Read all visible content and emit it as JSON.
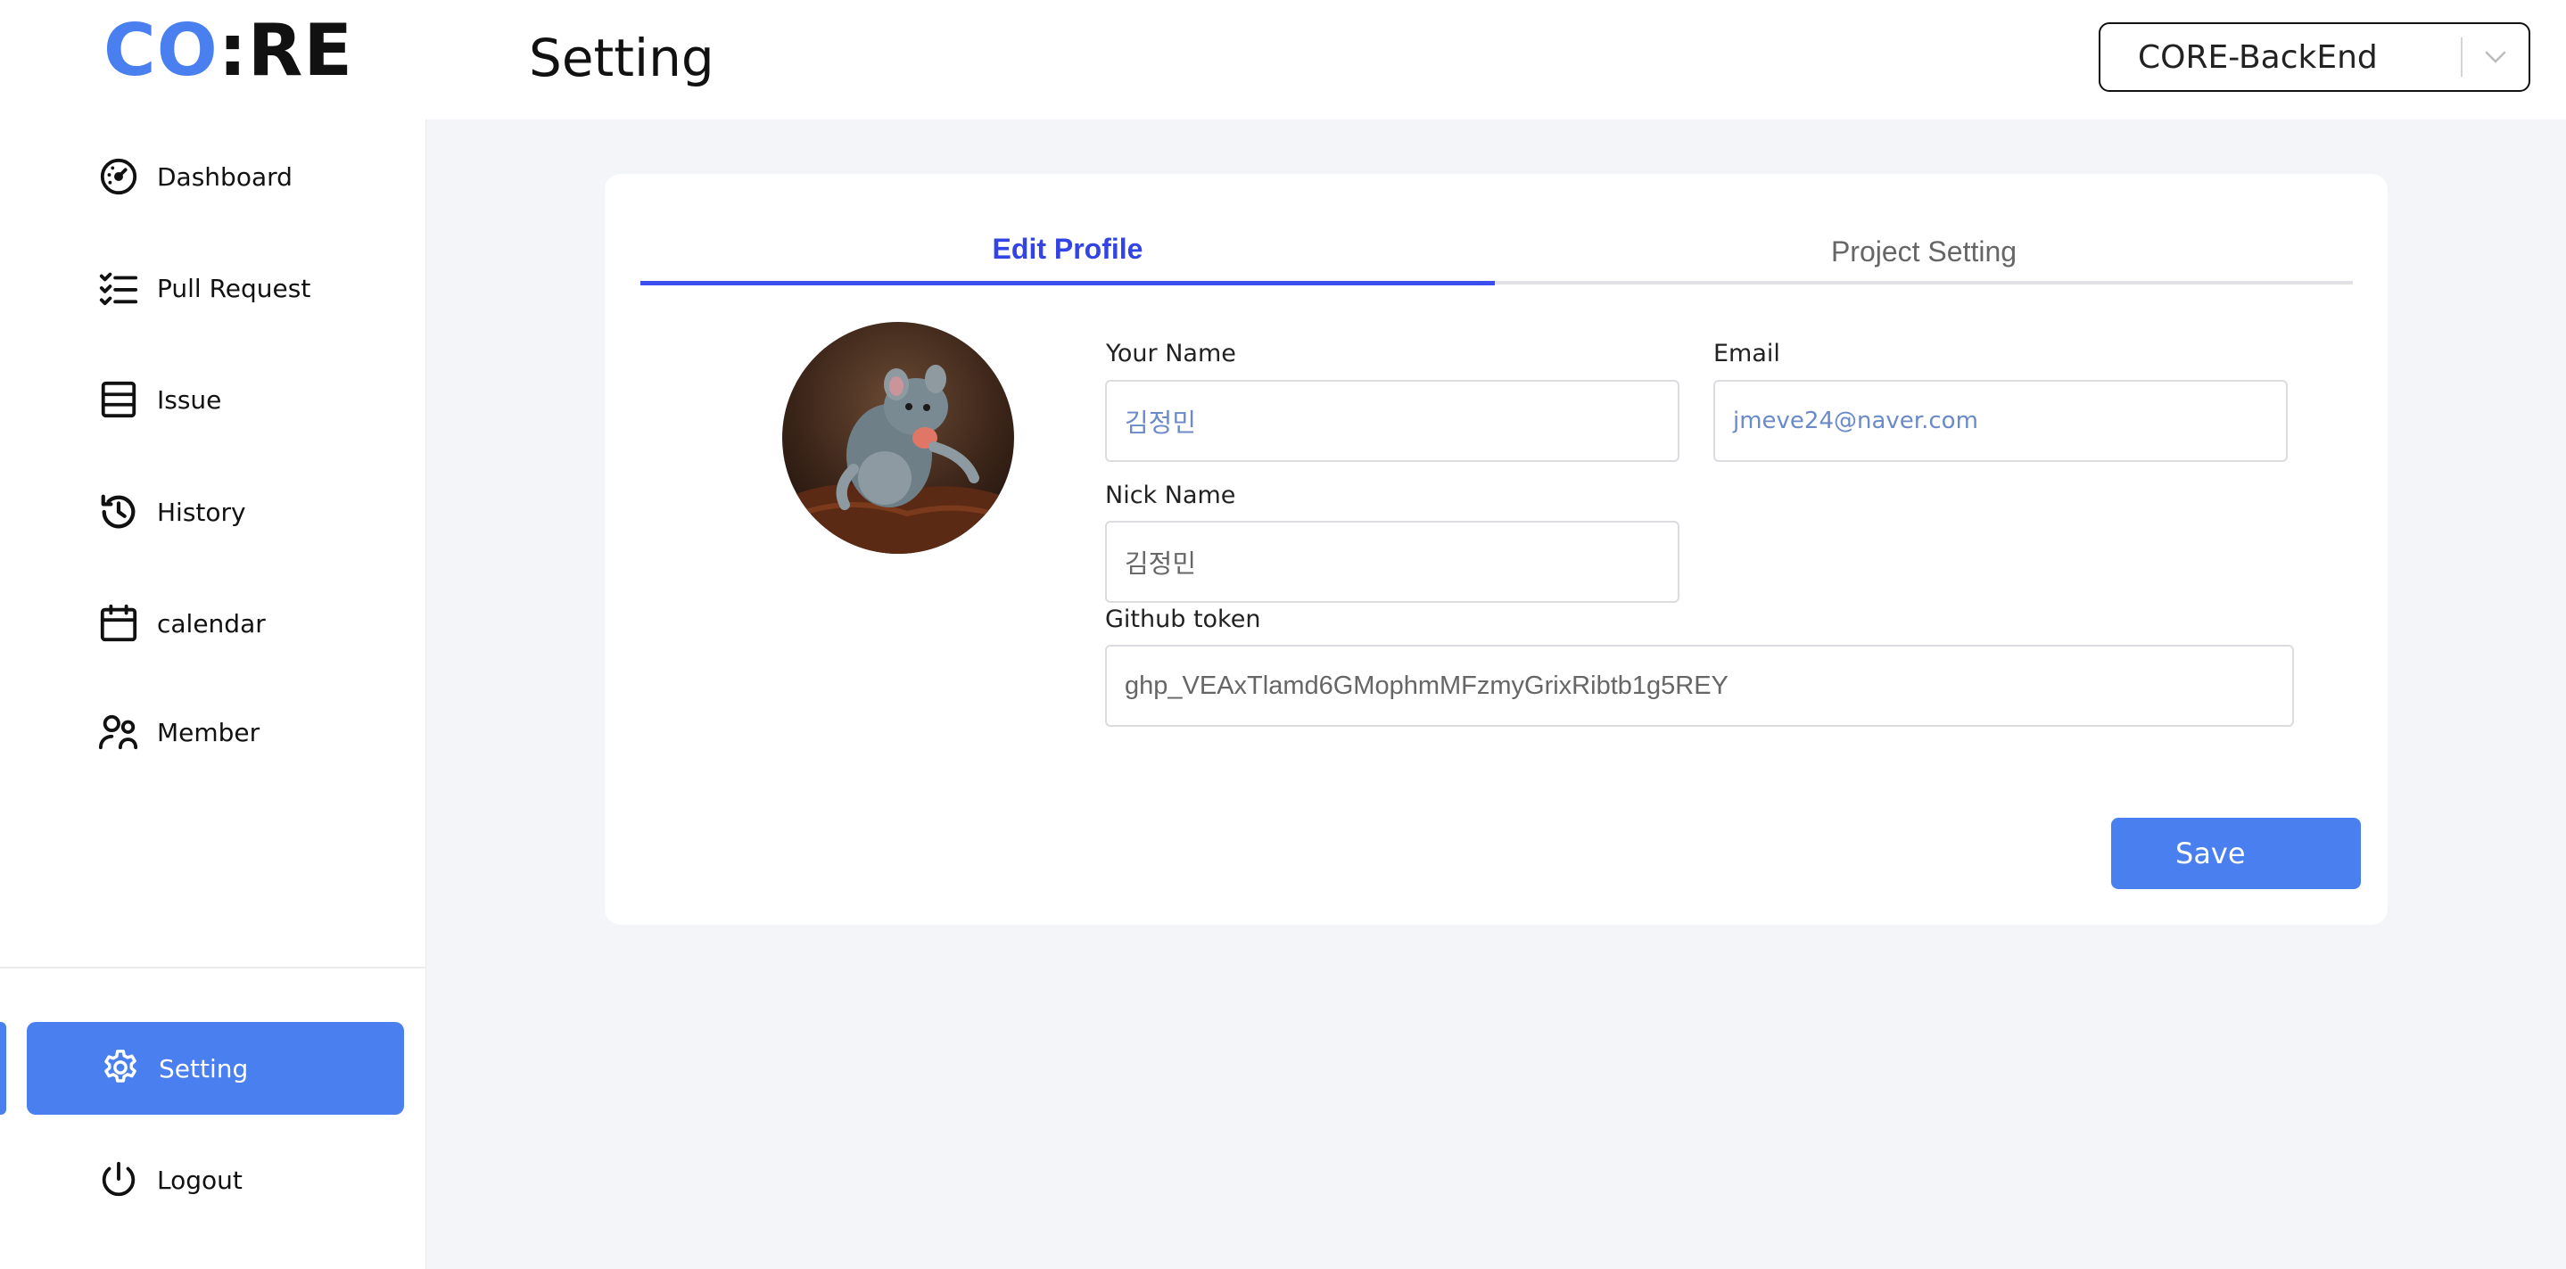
{
  "brand": {
    "logo_part1": "CO",
    "logo_colon": ":",
    "logo_part2": "RE"
  },
  "header": {
    "title": "Setting"
  },
  "project_select": {
    "value": "CORE-BackEnd"
  },
  "sidebar": {
    "items": [
      {
        "label": "Dashboard",
        "icon": "dashboard-gauge-icon"
      },
      {
        "label": "Pull Request",
        "icon": "checklist-icon"
      },
      {
        "label": "Issue",
        "icon": "list-box-icon"
      },
      {
        "label": "History",
        "icon": "history-icon"
      },
      {
        "label": "calendar",
        "icon": "calendar-icon"
      },
      {
        "label": "Member",
        "icon": "members-icon"
      }
    ],
    "active": {
      "label": "Setting",
      "icon": "gear-icon"
    },
    "logout": {
      "label": "Logout",
      "icon": "power-icon"
    }
  },
  "tabs": [
    {
      "label": "Edit Profile",
      "active": true
    },
    {
      "label": "Project Setting",
      "active": false
    }
  ],
  "profile": {
    "avatar_icon": "rat-avatar",
    "your_name": {
      "label": "Your Name",
      "placeholder": "김정민"
    },
    "email": {
      "label": "Email",
      "placeholder": "jmeve24@naver.com"
    },
    "nick_name": {
      "label": "Nick Name",
      "placeholder": "김정민"
    },
    "github_token": {
      "label": "Github token",
      "value": "ghp_VEAxTlamd6GMophmMFzmyGrixRibtb1g5REY"
    },
    "save_label": "Save"
  },
  "colors": {
    "accent": "#4a7ff0",
    "tab_active": "#3244e4",
    "background": "#f4f5f8"
  }
}
